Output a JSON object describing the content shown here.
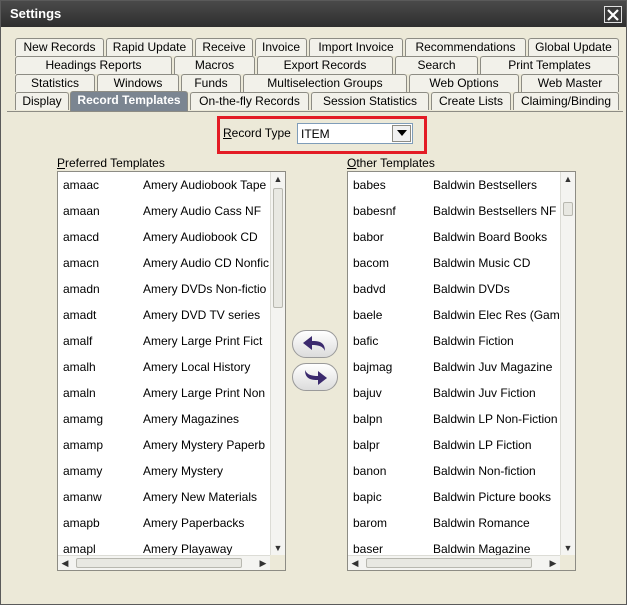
{
  "window": {
    "title": "Settings"
  },
  "icons": {
    "close": "close-icon",
    "dropdown": "chevron-down-icon",
    "move_left": "curved-arrow-left-icon",
    "move_right": "curved-arrow-right-icon"
  },
  "tabs": {
    "row1": [
      "New Records",
      "Rapid Update",
      "Receive",
      "Invoice",
      "Import Invoice",
      "Recommendations",
      "Global Update"
    ],
    "row2": [
      "Headings Reports",
      "Macros",
      "Export Records",
      "Search",
      "Print Templates"
    ],
    "row3": [
      "Statistics",
      "Windows",
      "Funds",
      "Multiselection Groups",
      "Web Options",
      "Web Master"
    ],
    "row4": [
      "Display",
      "Record Templates",
      "On-the-fly Records",
      "Session Statistics",
      "Create Lists",
      "Claiming/Binding"
    ],
    "active": "Record Templates"
  },
  "record_type": {
    "label_mnemonic": "R",
    "label_rest": "ecord Type",
    "value": "ITEM"
  },
  "preferred": {
    "title_mnemonic": "P",
    "title_rest": "referred Templates",
    "rows": [
      {
        "code": "amaac",
        "name": "Amery Audiobook Tape"
      },
      {
        "code": "amaan",
        "name": "Amery Audio Cass NF"
      },
      {
        "code": "amacd",
        "name": "Amery Audiobook CD"
      },
      {
        "code": "amacn",
        "name": "Amery Audio CD Nonfic"
      },
      {
        "code": "amadn",
        "name": "Amery DVDs Non-fictio"
      },
      {
        "code": "amadt",
        "name": "Amery DVD TV series"
      },
      {
        "code": "amalf",
        "name": "Amery Large Print Fict"
      },
      {
        "code": "amalh",
        "name": "Amery  Local History"
      },
      {
        "code": "amaln",
        "name": "Amery Large Print Non"
      },
      {
        "code": "amamg",
        "name": "Amery Magazines"
      },
      {
        "code": "amamp",
        "name": "Amery Mystery Paperb"
      },
      {
        "code": "amamy",
        "name": "Amery Mystery"
      },
      {
        "code": "amanw",
        "name": "Amery New Materials"
      },
      {
        "code": "amapb",
        "name": "Amery Paperbacks"
      },
      {
        "code": "amapl",
        "name": "Amery Playaway"
      }
    ]
  },
  "other": {
    "title_mnemonic": "O",
    "title_rest": "ther Templates",
    "rows": [
      {
        "code": "babes",
        "name": "Baldwin Bestsellers"
      },
      {
        "code": "babesnf",
        "name": "Baldwin Bestsellers NF"
      },
      {
        "code": "babor",
        "name": "Baldwin Board Books"
      },
      {
        "code": "bacom",
        "name": "Baldwin Music CD"
      },
      {
        "code": "badvd",
        "name": "Baldwin DVDs"
      },
      {
        "code": "baele",
        "name": "Baldwin Elec Res (Gam"
      },
      {
        "code": "bafic",
        "name": "Baldwin Fiction"
      },
      {
        "code": "bajmag",
        "name": "Baldwin Juv Magazine"
      },
      {
        "code": "bajuv",
        "name": "Baldwin Juv Fiction"
      },
      {
        "code": "balpn",
        "name": "Baldwin LP Non-Fiction"
      },
      {
        "code": "balpr",
        "name": "Baldwin LP Fiction"
      },
      {
        "code": "banon",
        "name": "Baldwin Non-fiction"
      },
      {
        "code": "bapic",
        "name": "Baldwin Picture books"
      },
      {
        "code": "barom",
        "name": "Baldwin Romance"
      },
      {
        "code": "baser",
        "name": "Baldwin Magazine"
      }
    ]
  },
  "colors": {
    "highlight": "#e31c25",
    "arrow": "#3b2a6e"
  }
}
